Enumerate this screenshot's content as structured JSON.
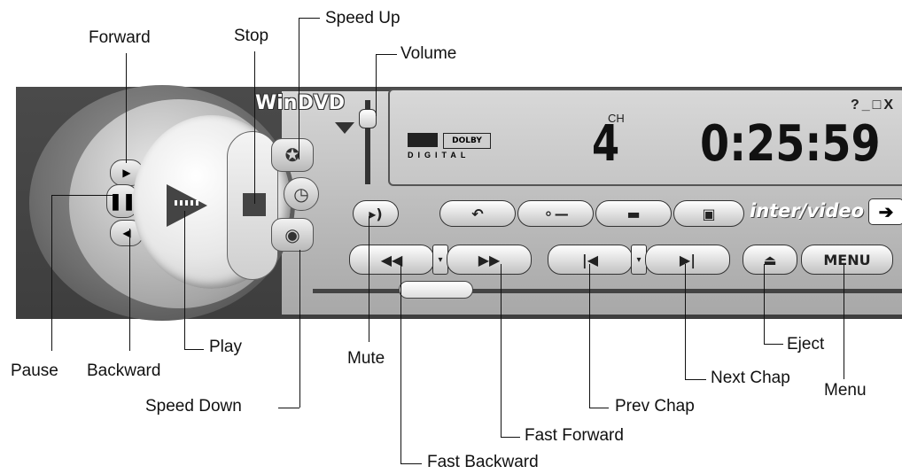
{
  "player": {
    "logo": "WinDVD",
    "brand": "inter/video",
    "window_controls": "?_□X",
    "display": {
      "channel_label": "CH",
      "channel_value": "4",
      "time": "0:25:59",
      "dolby_box": "DOLBY",
      "dolby_text": "DIGITAL"
    },
    "buttons": {
      "menu": "MENU",
      "next_arrow": "➔"
    }
  },
  "labels": {
    "forward": "Forward",
    "stop": "Stop",
    "speed_up": "Speed Up",
    "volume": "Volume",
    "pause": "Pause",
    "backward": "Backward",
    "play": "Play",
    "speed_down": "Speed Down",
    "mute": "Mute",
    "fast_backward": "Fast Backward",
    "fast_forward": "Fast Forward",
    "prev_chap": "Prev Chap",
    "next_chap": "Next Chap",
    "eject": "Eject",
    "menu": "Menu"
  }
}
